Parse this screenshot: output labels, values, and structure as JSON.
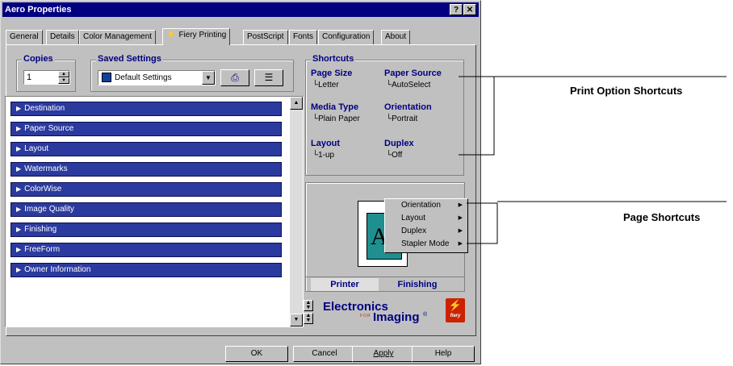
{
  "window": {
    "title": "Aero Properties",
    "help_label": "?",
    "close_label": "✕"
  },
  "tabs": [
    {
      "label": "General"
    },
    {
      "label": "Details"
    },
    {
      "label": "Color Management"
    },
    {
      "label": "Fiery Printing"
    },
    {
      "label": "PostScript"
    },
    {
      "label": "Fonts"
    },
    {
      "label": "Configuration"
    },
    {
      "label": "About"
    }
  ],
  "copies": {
    "label": "Copies",
    "value": "1"
  },
  "saved_settings": {
    "label": "Saved Settings",
    "value": "Default Settings"
  },
  "options_list": [
    {
      "label": "Destination"
    },
    {
      "label": "Paper Source"
    },
    {
      "label": "Layout"
    },
    {
      "label": "Watermarks"
    },
    {
      "label": "ColorWise"
    },
    {
      "label": "Image Quality"
    },
    {
      "label": "Finishing"
    },
    {
      "label": "FreeForm"
    },
    {
      "label": "Owner Information"
    }
  ],
  "shortcuts": {
    "label": "Shortcuts",
    "page_size": {
      "label": "Page Size",
      "value": "Letter"
    },
    "paper_source": {
      "label": "Paper Source",
      "value": "AutoSelect"
    },
    "media_type": {
      "label": "Media Type",
      "value": "Plain Paper"
    },
    "orientation": {
      "label": "Orientation",
      "value": "Portrait"
    },
    "layout": {
      "label": "Layout",
      "value": "1-up"
    },
    "duplex": {
      "label": "Duplex",
      "value": "Off"
    }
  },
  "preview": {
    "page_letter": "A",
    "tabs": [
      "Printer",
      "Finishing"
    ]
  },
  "context_menu": [
    "Orientation",
    "Layout",
    "Duplex",
    "Stapler Mode"
  ],
  "brand": {
    "line1": "Electronics",
    "for": "FOR",
    "line2": "Imaging",
    "tm": "®",
    "badge": "fiery"
  },
  "buttons": {
    "ok": "OK",
    "cancel": "Cancel",
    "apply": "Apply",
    "help": "Help"
  },
  "callouts": {
    "print_option_shortcuts": "Print Option Shortcuts",
    "page_shortcuts": "Page Shortcuts"
  },
  "colors": {
    "titlebar": "#000080",
    "list_item": "#2b3a9e",
    "accent_heading": "#000080",
    "preview_page": "#1f8f8f",
    "brand_red": "#cc2200"
  }
}
